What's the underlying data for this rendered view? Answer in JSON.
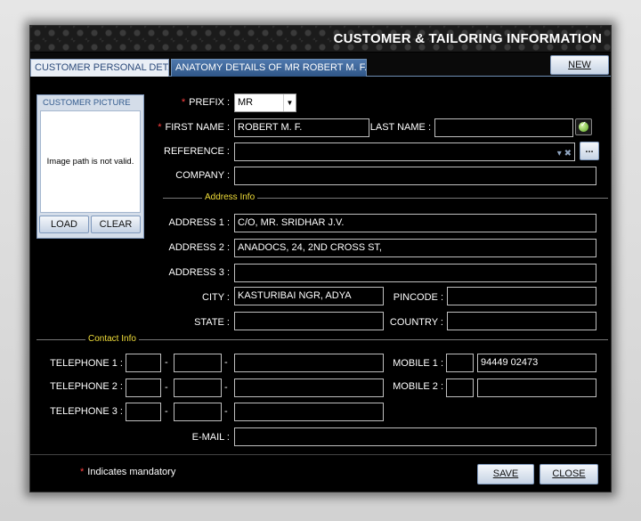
{
  "window": {
    "title": "CUSTOMER & TAILORING INFORMATION"
  },
  "tabs": [
    {
      "label": "CUSTOMER PERSONAL DETAILS",
      "active": true
    },
    {
      "label": "ANATOMY DETAILS OF MR ROBERT  M. F.",
      "active": false
    }
  ],
  "buttons": {
    "new": "NEW",
    "load": "LOAD",
    "clear": "CLEAR",
    "ellipsis": "...",
    "save": "SAVE",
    "close": "CLOSE"
  },
  "picture": {
    "title": "CUSTOMER PICTURE",
    "message": "Image path is not valid."
  },
  "fields": {
    "prefix": {
      "label": "PREFIX :",
      "value": "MR",
      "required": true
    },
    "first_name": {
      "label": "FIRST NAME :",
      "value": "ROBERT  M. F.",
      "required": true
    },
    "last_name": {
      "label": "LAST NAME :",
      "value": ""
    },
    "reference": {
      "label": "REFERENCE :",
      "value": ""
    },
    "company": {
      "label": "COMPANY :",
      "value": ""
    },
    "address1": {
      "label": "ADDRESS 1 :",
      "value": "C/O, MR. SRIDHAR  J.V."
    },
    "address2": {
      "label": "ADDRESS 2 :",
      "value": "ANADOCS, 24, 2ND CROSS ST,"
    },
    "address3": {
      "label": "ADDRESS 3 :",
      "value": ""
    },
    "city": {
      "label": "CITY :",
      "value": "KASTURIBAI NGR, ADYA"
    },
    "pincode": {
      "label": "PINCODE :",
      "value": ""
    },
    "state": {
      "label": "STATE :",
      "value": ""
    },
    "country": {
      "label": "COUNTRY :",
      "value": ""
    },
    "telephone1": {
      "label": "TELEPHONE 1 :",
      "country_code": "",
      "area_code": "",
      "number": ""
    },
    "telephone2": {
      "label": "TELEPHONE 2 :",
      "country_code": "",
      "area_code": "",
      "number": ""
    },
    "telephone3": {
      "label": "TELEPHONE 3 :",
      "country_code": "",
      "area_code": "",
      "number": ""
    },
    "mobile1": {
      "label": "MOBILE 1 :",
      "code": "",
      "number": "94449 02473"
    },
    "mobile2": {
      "label": "MOBILE 2 :",
      "code": "",
      "number": ""
    },
    "email": {
      "label": "E-MAIL :",
      "value": ""
    }
  },
  "sections": {
    "address": "Address Info",
    "contact": "Contact Info"
  },
  "footer": {
    "mandatory_note": "Indicates mandatory",
    "asterisk": "*"
  },
  "dash": "-",
  "colors": {
    "background": "#000000",
    "section_title": "#f2df3a",
    "required": "#ff4040",
    "tab_inactive": "#3a6399"
  }
}
